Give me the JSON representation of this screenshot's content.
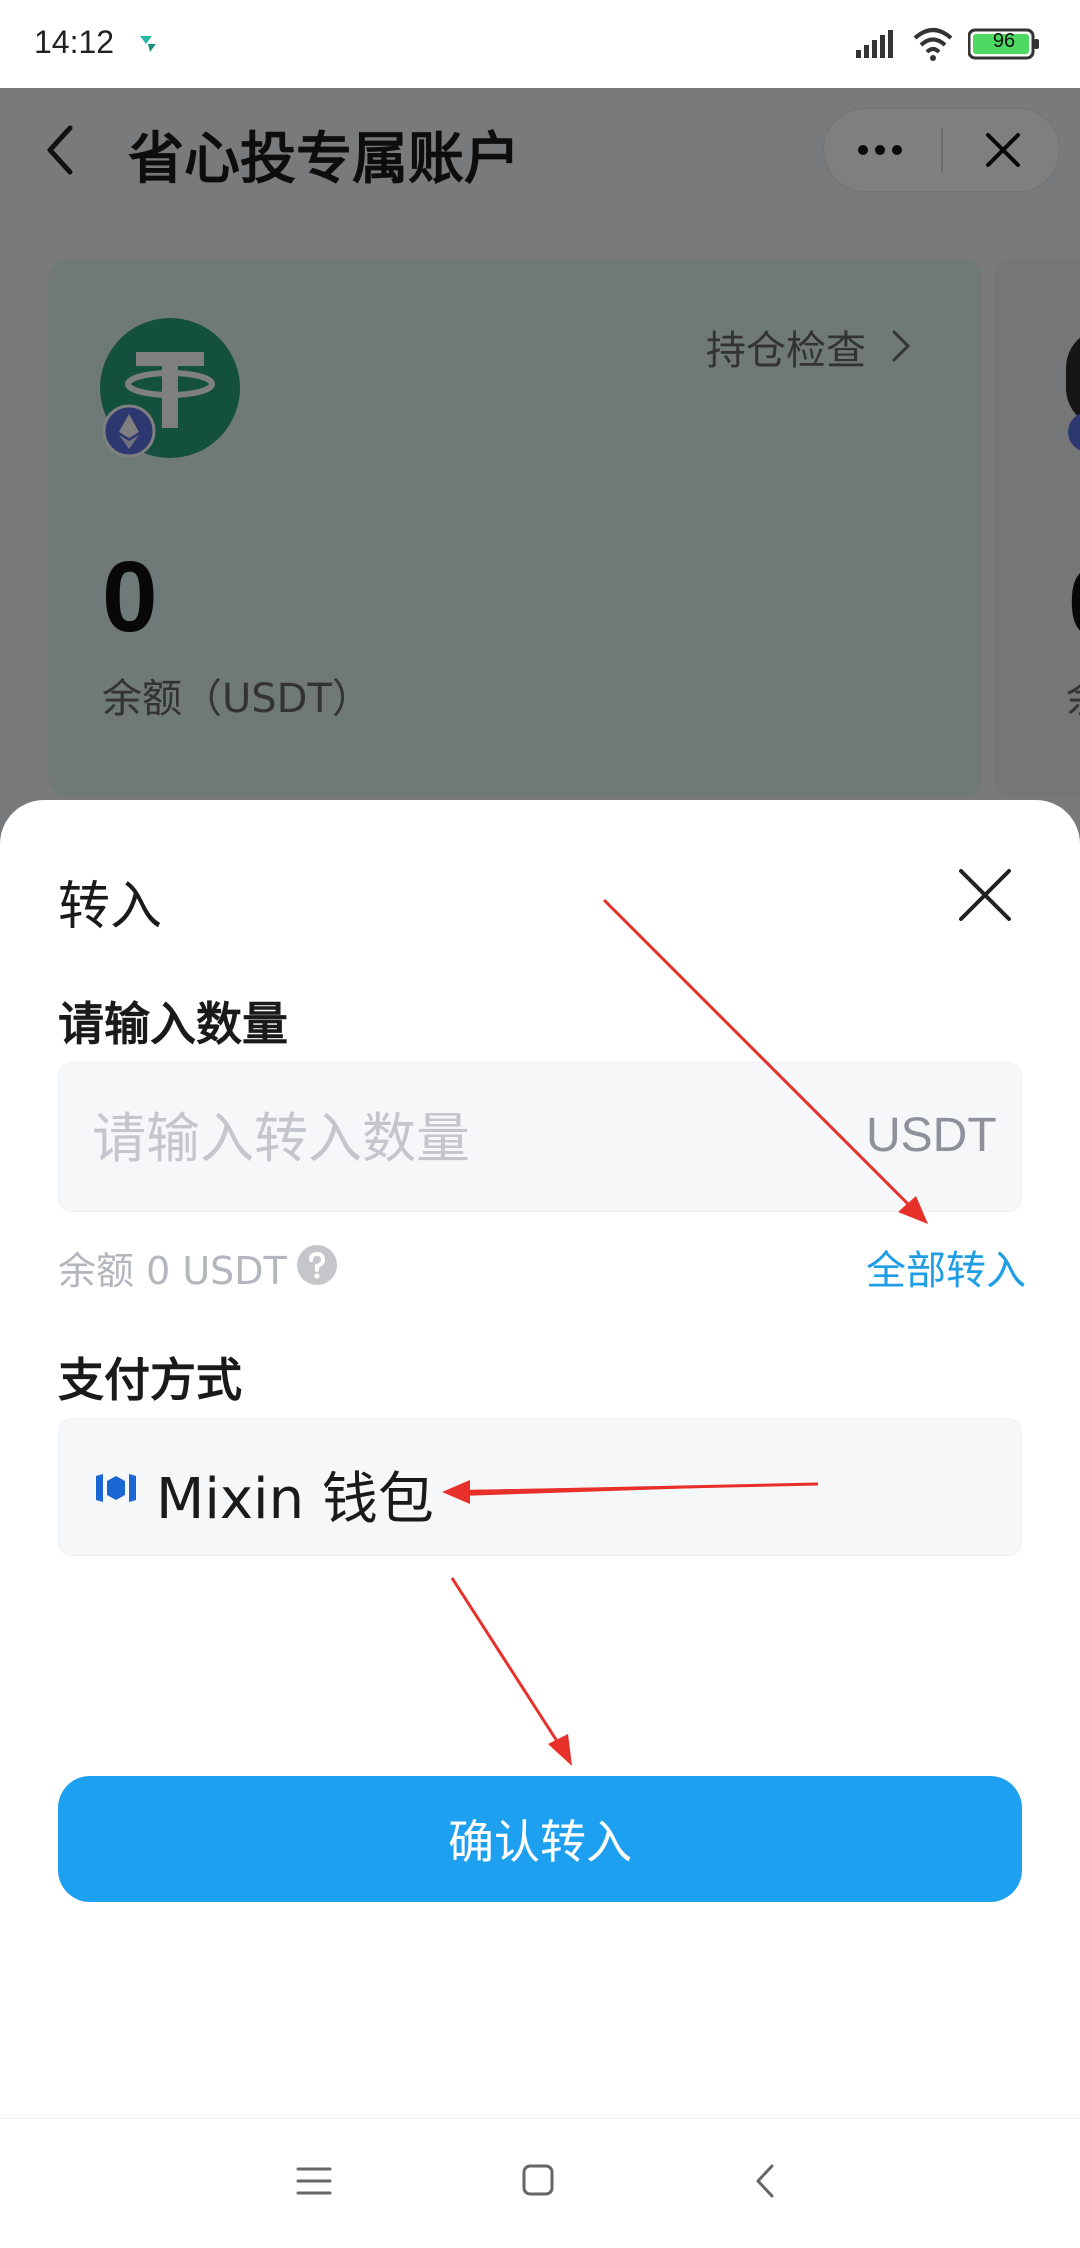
{
  "status_bar": {
    "time": "14:12",
    "battery": "96"
  },
  "header": {
    "title": "省心投专属账户"
  },
  "card": {
    "check_link": "持仓检查",
    "balance_value": "0",
    "balance_label": "余额（USDT）"
  },
  "sheet": {
    "title": "转入",
    "amount_label": "请输入数量",
    "amount_placeholder": "请输入转入数量",
    "amount_unit": "USDT",
    "balance_hint": "余额 0 USDT",
    "transfer_all": "全部转入",
    "pay_label": "支付方式",
    "pay_method": "Mixin 钱包",
    "confirm_label": "确认转入"
  },
  "colors": {
    "accent": "#1ea0f0",
    "link": "#1f9ee6",
    "annotation_arrow": "#e8302a",
    "usdt_green": "#26a17b"
  },
  "icons": {
    "app": "app-notification-icon",
    "signal": "signal-icon",
    "wifi": "wifi-icon",
    "battery": "battery-icon",
    "back": "back-arrow-icon",
    "more": "more-dots-icon",
    "close": "close-icon",
    "usdt": "usdt-logo-icon",
    "eth": "ethereum-badge-icon",
    "help": "help-question-icon",
    "mixin": "mixin-logo-icon"
  }
}
